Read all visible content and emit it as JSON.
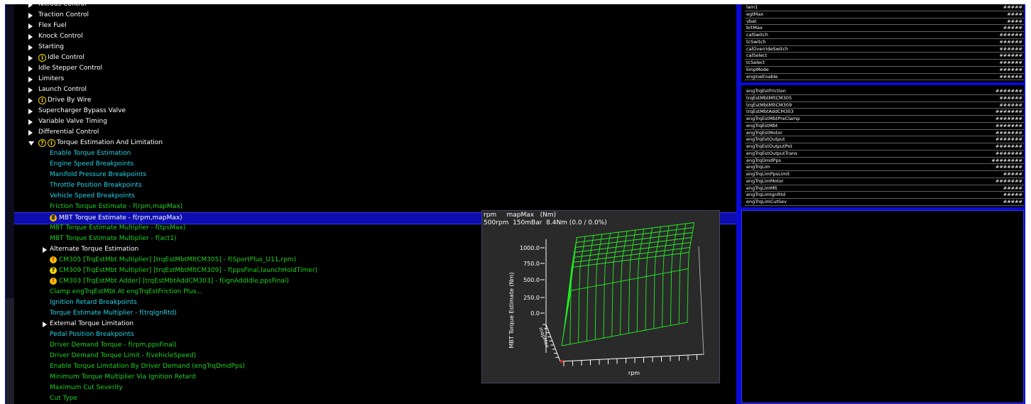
{
  "tree": {
    "items": [
      {
        "label": "Nitrous Control",
        "color": "white",
        "arrow": "r",
        "icon": "",
        "indent": 0
      },
      {
        "label": "Traction Control",
        "color": "white",
        "arrow": "r",
        "icon": "",
        "indent": 0
      },
      {
        "label": "Flex Fuel",
        "color": "white",
        "arrow": "r",
        "icon": "",
        "indent": 0
      },
      {
        "label": "Knock Control",
        "color": "white",
        "arrow": "r",
        "icon": "",
        "indent": 0
      },
      {
        "label": "Starting",
        "color": "white",
        "arrow": "r",
        "icon": "",
        "indent": 0
      },
      {
        "label": "Idle Control",
        "color": "white",
        "arrow": "r",
        "icon": "info",
        "indent": 0
      },
      {
        "label": "Idle Stepper Control",
        "color": "white",
        "arrow": "r",
        "icon": "",
        "indent": 0
      },
      {
        "label": "Limiters",
        "color": "white",
        "arrow": "r",
        "icon": "",
        "indent": 0
      },
      {
        "label": "Launch Control",
        "color": "white",
        "arrow": "r",
        "icon": "",
        "indent": 0
      },
      {
        "label": "Drive By Wire",
        "color": "white",
        "arrow": "r",
        "icon": "info",
        "indent": 0
      },
      {
        "label": "Supercharger Bypass Valve",
        "color": "white",
        "arrow": "r",
        "icon": "",
        "indent": 0
      },
      {
        "label": "Variable Valve Timing",
        "color": "white",
        "arrow": "r",
        "icon": "",
        "indent": 0
      },
      {
        "label": "Differential Control",
        "color": "white",
        "arrow": "r",
        "icon": "",
        "indent": 0
      },
      {
        "label": "Torque Estimation And Limitation",
        "color": "white",
        "arrow": "d",
        "icon": "helpinfo",
        "indent": 0
      },
      {
        "label": "Enable Torque Estimation",
        "color": "cyan",
        "arrow": "",
        "icon": "",
        "indent": 1
      },
      {
        "label": "Engine Speed Breakpoints",
        "color": "cyan",
        "arrow": "",
        "icon": "",
        "indent": 1
      },
      {
        "label": "Manifold Pressure Breakpoints",
        "color": "cyan",
        "arrow": "",
        "icon": "",
        "indent": 1
      },
      {
        "label": "Throttle Position Breakpoints",
        "color": "cyan",
        "arrow": "",
        "icon": "",
        "indent": 1
      },
      {
        "label": "Vehicle Speed Breakpoints",
        "color": "cyan",
        "arrow": "",
        "icon": "",
        "indent": 1
      },
      {
        "label": "Friction Torque Estimate - f(rpm,mapMax)",
        "color": "green",
        "arrow": "",
        "icon": "",
        "indent": 1
      },
      {
        "label": "MBT Torque Estimate - f(rpm,mapMax)",
        "color": "white",
        "arrow": "",
        "icon": "sel",
        "indent": 1,
        "selected": true
      },
      {
        "label": "MBT Torque Estimate Multiplier - f(tpsMax)",
        "color": "green",
        "arrow": "",
        "icon": "",
        "indent": 1
      },
      {
        "label": "MBT Torque Estimate Multiplier - f(act1)",
        "color": "green",
        "arrow": "",
        "icon": "",
        "indent": 1
      },
      {
        "label": "Alternate Torque Estimation",
        "color": "white",
        "arrow": "r",
        "icon": "",
        "indent": 1
      },
      {
        "label": "CM305 [TrqEstMbt Multiplier] [trqEstMbtMltCM305] - f(SportPlus_U11,rpm)",
        "color": "green",
        "arrow": "",
        "icon": "warn",
        "indent": 1
      },
      {
        "label": "CM309 [TrqEstMbt Multiplier] [trqEstMbtMltCM309] - f(ppsFinal,launchHoldTimer)",
        "color": "green",
        "arrow": "",
        "icon": "help",
        "indent": 1
      },
      {
        "label": "CM303 [TrqEstMbt Adder] [trqEstMbtAddCM303] - f(ignAddIdle,ppsFinal)",
        "color": "green",
        "arrow": "",
        "icon": "warn",
        "indent": 1
      },
      {
        "label": "Clamp engTrqEstMbt At engTrqEstFriction Plus...",
        "color": "green",
        "arrow": "",
        "icon": "",
        "indent": 1
      },
      {
        "label": "Ignition Retard Breakpoints",
        "color": "cyan",
        "arrow": "",
        "icon": "",
        "indent": 1
      },
      {
        "label": "Torque Estimate Multiplier - f(trqIgnRtd)",
        "color": "cyan",
        "arrow": "",
        "icon": "",
        "indent": 1
      },
      {
        "label": "External Torque Limitation",
        "color": "white",
        "arrow": "r",
        "icon": "",
        "indent": 1
      },
      {
        "label": "Pedal Position Breakpoints",
        "color": "cyan",
        "arrow": "",
        "icon": "",
        "indent": 1
      },
      {
        "label": "Driver Demand Torque - f(rpm,ppsFinal)",
        "color": "green",
        "arrow": "",
        "icon": "",
        "indent": 1
      },
      {
        "label": "Driver Demand Torque Limit - f(vehicleSpeed)",
        "color": "green",
        "arrow": "",
        "icon": "",
        "indent": 1
      },
      {
        "label": "Enable Torque Limitation By Driver Demand (engTrqDmdPps)",
        "color": "green",
        "arrow": "",
        "icon": "",
        "indent": 1
      },
      {
        "label": "Minimum Torque Multiplier Via Ignition Retard",
        "color": "green",
        "arrow": "",
        "icon": "",
        "indent": 1
      },
      {
        "label": "Maximum Cut Severity",
        "color": "green",
        "arrow": "",
        "icon": "",
        "indent": 1
      },
      {
        "label": "Cut Type",
        "color": "green",
        "arrow": "",
        "icon": "",
        "indent": 1
      }
    ]
  },
  "chart": {
    "header_line1": "rpm     mapMax   (Nm)",
    "header_line2": "500rpm  150mBar  8.4Nm (0.0 / 0.0%)",
    "ylabel": "MBT Torque Estimate (Nm)",
    "yticks": [
      "1000.0",
      "750.0",
      "500.0",
      "250.0",
      "0.0"
    ],
    "depth_label": "mapMax",
    "xlabel": "rpm",
    "mesh_color": "#22ee22",
    "background": "#2a2a2a"
  },
  "table1": [
    {
      "name": "lam1",
      "value": "#####"
    },
    {
      "name": "egtMax",
      "value": "####"
    },
    {
      "name": "vbat",
      "value": "####"
    },
    {
      "name": "brtMax",
      "value": "#####"
    },
    {
      "name": "calSwitch",
      "value": "######"
    },
    {
      "name": "tcSwitch",
      "value": "######"
    },
    {
      "name": "calOverrideSwitch",
      "value": "######"
    },
    {
      "name": "calSelect",
      "value": "######"
    },
    {
      "name": "tcSelect",
      "value": "######"
    },
    {
      "name": "limpMode",
      "value": "######"
    },
    {
      "name": "engineEnable",
      "value": "######"
    }
  ],
  "table2": [
    {
      "name": "engTrqEstFriction",
      "value": "#######"
    },
    {
      "name": "trqEstMbtMltCM305",
      "value": "######"
    },
    {
      "name": "trqEstMbtMltCM309",
      "value": "######"
    },
    {
      "name": "trqEstMbtAddCM303",
      "value": "#######"
    },
    {
      "name": "engTrqEstMbtPreClamp",
      "value": "#######"
    },
    {
      "name": "engTrqEstMbt",
      "value": "#######"
    },
    {
      "name": "engTrqEstMotor",
      "value": "#######"
    },
    {
      "name": "engTrqEstOutput",
      "value": "#######"
    },
    {
      "name": "engTrqEstOutputPot",
      "value": "#######"
    },
    {
      "name": "engTrqEstOutputTrans",
      "value": "#######"
    },
    {
      "name": "engTrqDmdPps",
      "value": "########"
    },
    {
      "name": "engTrqLim",
      "value": "#######"
    },
    {
      "name": "engTrqLimPpsLimit",
      "value": "#####"
    },
    {
      "name": "engTrqLimMotor",
      "value": "#######"
    },
    {
      "name": "engTrqLimMlt",
      "value": "#####"
    },
    {
      "name": "engTrqLimIgnRtd",
      "value": "#####"
    },
    {
      "name": "engTrqLimCutSev",
      "value": "#####"
    }
  ]
}
